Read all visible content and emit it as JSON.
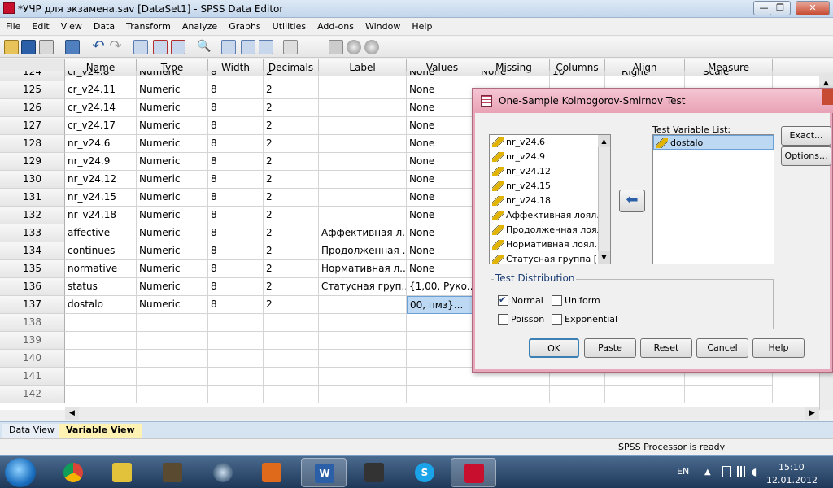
{
  "window": {
    "title": "*УЧР для экзамена.sav [DataSet1] - SPSS Data Editor",
    "minimize": "—",
    "restore": "❐",
    "close": "✕"
  },
  "menu": [
    "File",
    "Edit",
    "View",
    "Data",
    "Transform",
    "Analyze",
    "Graphs",
    "Utilities",
    "Add-ons",
    "Window",
    "Help"
  ],
  "grid": {
    "headers": [
      "Name",
      "Type",
      "Width",
      "Decimals",
      "Label",
      "Values",
      "Missing",
      "Columns",
      "Align",
      "Measure"
    ],
    "partial_row": {
      "num": "124",
      "name": "cr_v24.8",
      "type": "Numeric",
      "width": "8",
      "decimals": "2",
      "label": "",
      "values": "None",
      "missing": "None",
      "columns": "10",
      "align": "Right",
      "measure": "Scale"
    },
    "rows": [
      {
        "num": "125",
        "name": "cr_v24.11",
        "type": "Numeric",
        "width": "8",
        "decimals": "2",
        "label": "",
        "values": "None"
      },
      {
        "num": "126",
        "name": "cr_v24.14",
        "type": "Numeric",
        "width": "8",
        "decimals": "2",
        "label": "",
        "values": "None"
      },
      {
        "num": "127",
        "name": "cr_v24.17",
        "type": "Numeric",
        "width": "8",
        "decimals": "2",
        "label": "",
        "values": "None"
      },
      {
        "num": "128",
        "name": "nr_v24.6",
        "type": "Numeric",
        "width": "8",
        "decimals": "2",
        "label": "",
        "values": "None"
      },
      {
        "num": "129",
        "name": "nr_v24.9",
        "type": "Numeric",
        "width": "8",
        "decimals": "2",
        "label": "",
        "values": "None"
      },
      {
        "num": "130",
        "name": "nr_v24.12",
        "type": "Numeric",
        "width": "8",
        "decimals": "2",
        "label": "",
        "values": "None"
      },
      {
        "num": "131",
        "name": "nr_v24.15",
        "type": "Numeric",
        "width": "8",
        "decimals": "2",
        "label": "",
        "values": "None"
      },
      {
        "num": "132",
        "name": "nr_v24.18",
        "type": "Numeric",
        "width": "8",
        "decimals": "2",
        "label": "",
        "values": "None"
      },
      {
        "num": "133",
        "name": "affective",
        "type": "Numeric",
        "width": "8",
        "decimals": "2",
        "label": "Аффективная л...",
        "values": "None"
      },
      {
        "num": "134",
        "name": "continues",
        "type": "Numeric",
        "width": "8",
        "decimals": "2",
        "label": "Продолженная ...",
        "values": "None"
      },
      {
        "num": "135",
        "name": "normative",
        "type": "Numeric",
        "width": "8",
        "decimals": "2",
        "label": "Нормативная л...",
        "values": "None"
      },
      {
        "num": "136",
        "name": "status",
        "type": "Numeric",
        "width": "8",
        "decimals": "2",
        "label": "Статусная груп...",
        "values": "{1,00, Руко..."
      },
      {
        "num": "137",
        "name": "dostalo",
        "type": "Numeric",
        "width": "8",
        "decimals": "2",
        "label": "",
        "values": "00, пмз}..."
      }
    ],
    "empty_rows": [
      "138",
      "139",
      "140",
      "141",
      "142"
    ]
  },
  "tabs": {
    "data_view": "Data View",
    "variable_view": "Variable View"
  },
  "status": "SPSS  Processor is ready",
  "taskbar": {
    "lang": "EN",
    "time": "15:10",
    "date": "12.01.2012"
  },
  "dialog": {
    "title": "One-Sample Kolmogorov-Smirnov Test",
    "source_list": [
      "nr_v24.6",
      "nr_v24.9",
      "nr_v24.12",
      "nr_v24.15",
      "nr_v24.18",
      "Аффективная лоял...",
      "Продолженная лоял...",
      "Нормативная лоял...",
      "Статусная группа [..."
    ],
    "test_list_label": "Test Variable List:",
    "test_list": [
      "dostalo"
    ],
    "exact": "Exact...",
    "options": "Options...",
    "dist_label": "Test Distribution",
    "normal": "Normal",
    "uniform": "Uniform",
    "poisson": "Poisson",
    "exponential": "Exponential",
    "ok": "OK",
    "paste": "Paste",
    "reset": "Reset",
    "cancel": "Cancel",
    "help": "Help"
  }
}
